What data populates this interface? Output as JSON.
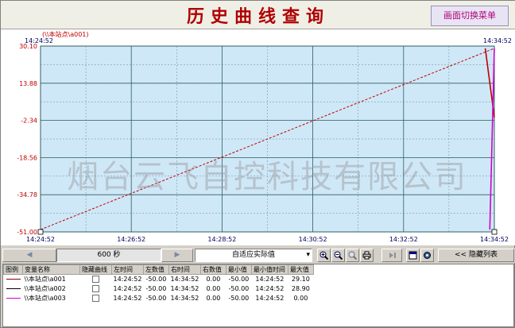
{
  "header": {
    "title": "历史曲线查询",
    "menu_button": "画面切换菜单"
  },
  "colors": {
    "plot_bg": "#cfe8f8",
    "grid": "#2f5f5f",
    "series_red": "#c00000",
    "series_black": "#000000",
    "series_magenta": "#d000d0",
    "accent_title": "#b00000"
  },
  "chart": {
    "series_tag": "(\\\\本站点\\a001)",
    "start_time_top": "14:24:52",
    "end_time_top": "14:34:52",
    "watermark": "烟台云飞自控科技有限公司"
  },
  "chart_data": {
    "type": "line",
    "ylim": [
      -51.0,
      30.1
    ],
    "yticks": [
      "30.10",
      "13.88",
      "-2.34",
      "-18.56",
      "-34.78",
      "-51.00"
    ],
    "xticks": [
      "14:24:52",
      "14:26:52",
      "14:28:52",
      "14:30:52",
      "14:32:52",
      "14:34:52"
    ],
    "grid": true,
    "series": [
      {
        "name": "\\\\本站点\\a001",
        "color": "#c00000",
        "style": "dashed",
        "x": [
          "14:24:52",
          "14:34:52"
        ],
        "y": [
          -50.0,
          29.1
        ]
      },
      {
        "name": "\\\\本站点\\a001",
        "color": "#c00000",
        "style": "solid",
        "x": [
          "14:34:40",
          "14:34:52"
        ],
        "y": [
          29.1,
          -1.0
        ]
      },
      {
        "name": "\\\\本站点\\a003",
        "color": "#d000d0",
        "style": "solid",
        "x": [
          "14:34:46",
          "14:34:52"
        ],
        "y": [
          -50.0,
          29.1
        ]
      }
    ]
  },
  "toolbar": {
    "prev_arrow": "◀",
    "duration": "600 秒",
    "next_arrow": "▶",
    "scale_mode": "自适应实际值",
    "hide_list": "<< 隐藏列表"
  },
  "table": {
    "headers": [
      "图例",
      "变量名称",
      "隐藏曲线",
      "左时间",
      "左数值",
      "右时间",
      "右数值",
      "最小值",
      "最小值时间",
      "最大值"
    ],
    "rows": [
      {
        "legend_color": "#8b0000",
        "name": "\\\\本站点\\a001",
        "left_time": "14:24:52",
        "left_value": "-50.00",
        "right_time": "14:34:52",
        "right_value": "0.00",
        "min": "-50.00",
        "min_time": "14:24:52",
        "max": "29.10"
      },
      {
        "legend_color": "#000000",
        "name": "\\\\本站点\\a002",
        "left_time": "14:24:52",
        "left_value": "-50.00",
        "right_time": "14:34:52",
        "right_value": "0.00",
        "min": "-50.00",
        "min_time": "14:24:52",
        "max": "28.90"
      },
      {
        "legend_color": "#d000d0",
        "name": "\\\\本站点\\a003",
        "left_time": "14:24:52",
        "left_value": "-50.00",
        "right_time": "14:34:52",
        "right_value": "0.00",
        "min": "-50.00",
        "min_time": "14:24:52",
        "max": "0.00"
      }
    ]
  }
}
